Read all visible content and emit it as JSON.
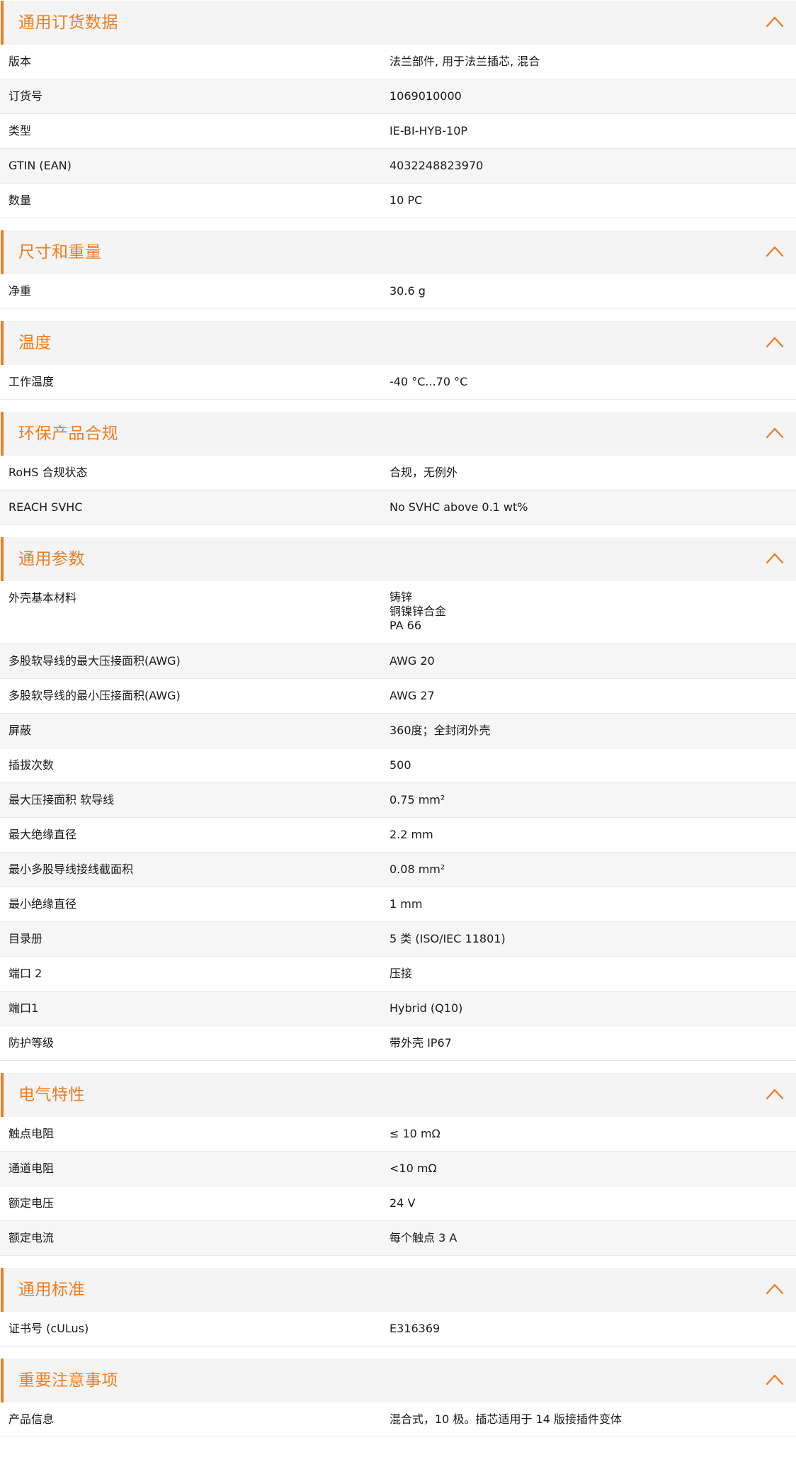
{
  "accent_color": "#f07d22",
  "icons": {
    "collapse": "chevron-up-icon"
  },
  "sections": [
    {
      "title": "通用订货数据",
      "rows": [
        {
          "label": "版本",
          "value": "法兰部件, 用于法兰插芯, 混合"
        },
        {
          "label": "订货号",
          "value": "1069010000"
        },
        {
          "label": "类型",
          "value": "IE-BI-HYB-10P"
        },
        {
          "label": "GTIN (EAN)",
          "value": "4032248823970"
        },
        {
          "label": "数量",
          "value": "10  PC"
        }
      ]
    },
    {
      "title": "尺寸和重量",
      "rows": [
        {
          "label": "净重",
          "value": "30.6  g"
        }
      ]
    },
    {
      "title": "温度",
      "rows": [
        {
          "label": "工作温度",
          "value": "-40 °C...70 °C"
        }
      ]
    },
    {
      "title": "环保产品合规",
      "rows": [
        {
          "label": "RoHS 合规状态",
          "value": "合规，无例外"
        },
        {
          "label": "REACH SVHC",
          "value": "No SVHC above 0.1 wt%"
        }
      ]
    },
    {
      "title": "通用参数",
      "rows": [
        {
          "label": "外壳基本材料",
          "lines": [
            "铸锌",
            "铜镍锌合金",
            "PA 66"
          ]
        },
        {
          "label": "多股软导线的最大压接面积(AWG)",
          "value": "AWG 20"
        },
        {
          "label": "多股软导线的最小压接面积(AWG)",
          "value": "AWG 27"
        },
        {
          "label": "屏蔽",
          "value": "360度；全封闭外壳"
        },
        {
          "label": "插拔次数",
          "value": "500"
        },
        {
          "label": "最大压接面积 软导线",
          "value": "0.75  mm²"
        },
        {
          "label": "最大绝缘直径",
          "value": "2.2  mm"
        },
        {
          "label": "最小多股导线接线截面积",
          "value": "0.08  mm²"
        },
        {
          "label": "最小绝缘直径",
          "value": "1  mm"
        },
        {
          "label": "目录册",
          "value": "5 类 (ISO/IEC 11801)"
        },
        {
          "label": "端口 2",
          "value": "压接"
        },
        {
          "label": "端口1",
          "value": "Hybrid (Q10)"
        },
        {
          "label": "防护等级",
          "value": "带外壳 IP67"
        }
      ]
    },
    {
      "title": "电气特性",
      "rows": [
        {
          "label": "触点电阻",
          "value": "≤ 10 mΩ"
        },
        {
          "label": "通道电阻",
          "value": "<10 mΩ"
        },
        {
          "label": "额定电压",
          "value": "24  V"
        },
        {
          "label": "额定电流",
          "value": "每个触点 3 A"
        }
      ]
    },
    {
      "title": "通用标准",
      "rows": [
        {
          "label": "证书号 (cULus)",
          "value": "E316369"
        }
      ]
    },
    {
      "title": "重要注意事项",
      "rows": [
        {
          "label": "产品信息",
          "value": "混合式，10 极。插芯适用于 14 版接插件变体"
        }
      ]
    }
  ]
}
